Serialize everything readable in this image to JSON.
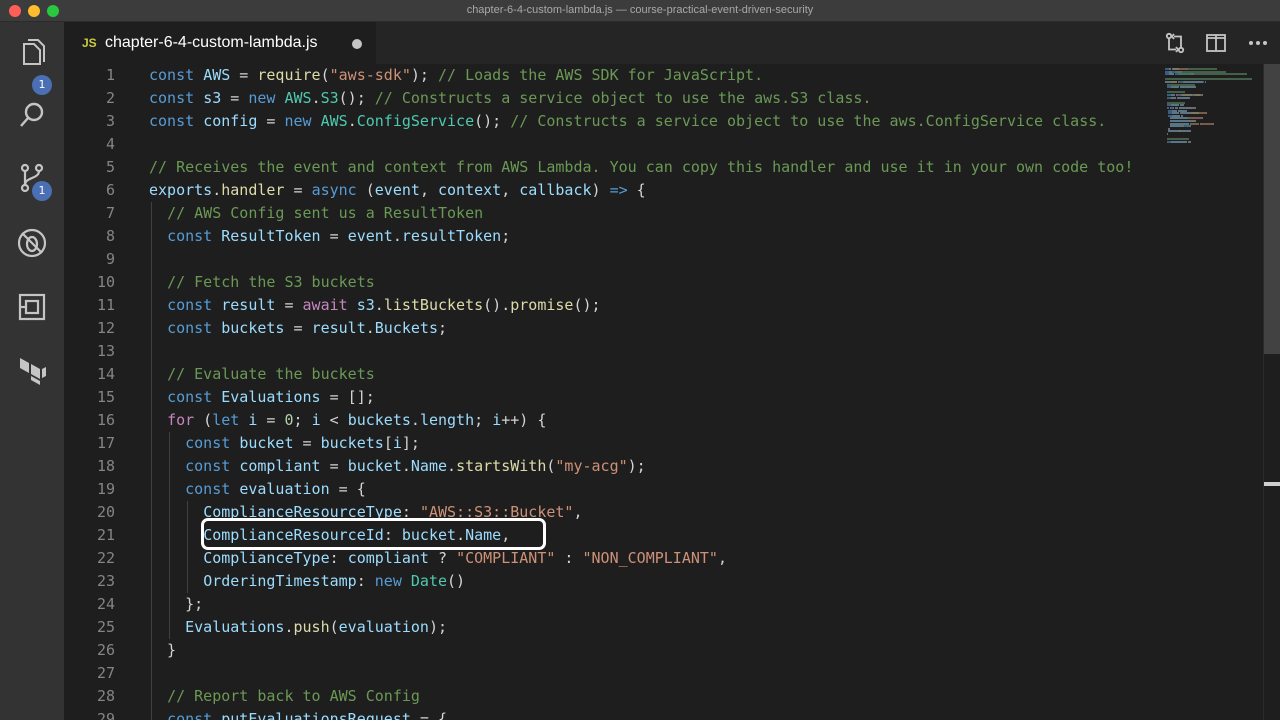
{
  "window": {
    "title": "chapter-6-4-custom-lambda.js — course-practical-event-driven-security"
  },
  "activity_bar": {
    "explorer_badge": "1",
    "source_control_badge": "1"
  },
  "tab": {
    "icon_text": "JS",
    "label": "chapter-6-4-custom-lambda.js"
  },
  "editor": {
    "lines": [
      {
        "n": "1",
        "tokens": [
          [
            "kw",
            "const "
          ],
          [
            "var",
            "AWS"
          ],
          [
            "pl",
            " = "
          ],
          [
            "fn",
            "require"
          ],
          [
            "pl",
            "("
          ],
          [
            "str",
            "\"aws-sdk\""
          ],
          [
            "pl",
            "); "
          ],
          [
            "cm",
            "// Loads the AWS SDK for JavaScript."
          ]
        ]
      },
      {
        "n": "2",
        "tokens": [
          [
            "kw",
            "const "
          ],
          [
            "var",
            "s3"
          ],
          [
            "pl",
            " = "
          ],
          [
            "kw",
            "new "
          ],
          [
            "cls",
            "AWS"
          ],
          [
            "pl",
            "."
          ],
          [
            "cls",
            "S3"
          ],
          [
            "pl",
            "(); "
          ],
          [
            "cm",
            "// Constructs a service object to use the aws.S3 class."
          ]
        ]
      },
      {
        "n": "3",
        "tokens": [
          [
            "kw",
            "const "
          ],
          [
            "var",
            "config"
          ],
          [
            "pl",
            " = "
          ],
          [
            "kw",
            "new "
          ],
          [
            "cls",
            "AWS"
          ],
          [
            "pl",
            "."
          ],
          [
            "cls",
            "ConfigService"
          ],
          [
            "pl",
            "(); "
          ],
          [
            "cm",
            "// Constructs a service object to use the aws.ConfigService class."
          ]
        ]
      },
      {
        "n": "4",
        "tokens": []
      },
      {
        "n": "5",
        "tokens": [
          [
            "cm",
            "// Receives the event and context from AWS Lambda. You can copy this handler and use it in your own code too!"
          ]
        ]
      },
      {
        "n": "6",
        "tokens": [
          [
            "var",
            "exports"
          ],
          [
            "pl",
            "."
          ],
          [
            "fn",
            "handler"
          ],
          [
            "pl",
            " = "
          ],
          [
            "kw",
            "async"
          ],
          [
            "pl",
            " ("
          ],
          [
            "var",
            "event"
          ],
          [
            "pl",
            ", "
          ],
          [
            "var",
            "context"
          ],
          [
            "pl",
            ", "
          ],
          [
            "var",
            "callback"
          ],
          [
            "pl",
            ") "
          ],
          [
            "kw",
            "=>"
          ],
          [
            "pl",
            " {"
          ]
        ]
      },
      {
        "n": "7",
        "tokens": [
          [
            "pl",
            "  "
          ],
          [
            "cm",
            "// AWS Config sent us a ResultToken"
          ]
        ]
      },
      {
        "n": "8",
        "tokens": [
          [
            "pl",
            "  "
          ],
          [
            "kw",
            "const "
          ],
          [
            "var",
            "ResultToken"
          ],
          [
            "pl",
            " = "
          ],
          [
            "var",
            "event"
          ],
          [
            "pl",
            "."
          ],
          [
            "var",
            "resultToken"
          ],
          [
            "pl",
            ";"
          ]
        ]
      },
      {
        "n": "9",
        "tokens": []
      },
      {
        "n": "10",
        "tokens": [
          [
            "pl",
            "  "
          ],
          [
            "cm",
            "// Fetch the S3 buckets"
          ]
        ]
      },
      {
        "n": "11",
        "tokens": [
          [
            "pl",
            "  "
          ],
          [
            "kw",
            "const "
          ],
          [
            "var",
            "result"
          ],
          [
            "pl",
            " = "
          ],
          [
            "ctl",
            "await "
          ],
          [
            "var",
            "s3"
          ],
          [
            "pl",
            "."
          ],
          [
            "fn",
            "listBuckets"
          ],
          [
            "pl",
            "()."
          ],
          [
            "fn",
            "promise"
          ],
          [
            "pl",
            "();"
          ]
        ]
      },
      {
        "n": "12",
        "tokens": [
          [
            "pl",
            "  "
          ],
          [
            "kw",
            "const "
          ],
          [
            "var",
            "buckets"
          ],
          [
            "pl",
            " = "
          ],
          [
            "var",
            "result"
          ],
          [
            "pl",
            "."
          ],
          [
            "var",
            "Buckets"
          ],
          [
            "pl",
            ";"
          ]
        ]
      },
      {
        "n": "13",
        "tokens": []
      },
      {
        "n": "14",
        "tokens": [
          [
            "pl",
            "  "
          ],
          [
            "cm",
            "// Evaluate the buckets"
          ]
        ]
      },
      {
        "n": "15",
        "tokens": [
          [
            "pl",
            "  "
          ],
          [
            "kw",
            "const "
          ],
          [
            "var",
            "Evaluations"
          ],
          [
            "pl",
            " = [];"
          ]
        ]
      },
      {
        "n": "16",
        "tokens": [
          [
            "pl",
            "  "
          ],
          [
            "ctl",
            "for"
          ],
          [
            "pl",
            " ("
          ],
          [
            "kw",
            "let "
          ],
          [
            "var",
            "i"
          ],
          [
            "pl",
            " = "
          ],
          [
            "num",
            "0"
          ],
          [
            "pl",
            "; "
          ],
          [
            "var",
            "i"
          ],
          [
            "pl",
            " < "
          ],
          [
            "var",
            "buckets"
          ],
          [
            "pl",
            "."
          ],
          [
            "var",
            "length"
          ],
          [
            "pl",
            "; "
          ],
          [
            "var",
            "i"
          ],
          [
            "pl",
            "++) {"
          ]
        ]
      },
      {
        "n": "17",
        "tokens": [
          [
            "pl",
            "    "
          ],
          [
            "kw",
            "const "
          ],
          [
            "var",
            "bucket"
          ],
          [
            "pl",
            " = "
          ],
          [
            "var",
            "buckets"
          ],
          [
            "pl",
            "["
          ],
          [
            "var",
            "i"
          ],
          [
            "pl",
            "];"
          ]
        ]
      },
      {
        "n": "18",
        "tokens": [
          [
            "pl",
            "    "
          ],
          [
            "kw",
            "const "
          ],
          [
            "var",
            "compliant"
          ],
          [
            "pl",
            " = "
          ],
          [
            "var",
            "bucket"
          ],
          [
            "pl",
            "."
          ],
          [
            "var",
            "Name"
          ],
          [
            "pl",
            "."
          ],
          [
            "fn",
            "startsWith"
          ],
          [
            "pl",
            "("
          ],
          [
            "str",
            "\"my-acg\""
          ],
          [
            "pl",
            ");"
          ]
        ]
      },
      {
        "n": "19",
        "tokens": [
          [
            "pl",
            "    "
          ],
          [
            "kw",
            "const "
          ],
          [
            "var",
            "evaluation"
          ],
          [
            "pl",
            " = {"
          ]
        ]
      },
      {
        "n": "20",
        "tokens": [
          [
            "pl",
            "      "
          ],
          [
            "var",
            "ComplianceResourceType"
          ],
          [
            "pl",
            ": "
          ],
          [
            "str",
            "\"AWS::S3::Bucket\""
          ],
          [
            "pl",
            ","
          ]
        ]
      },
      {
        "n": "21",
        "tokens": [
          [
            "pl",
            "      "
          ],
          [
            "var",
            "ComplianceResourceId"
          ],
          [
            "pl",
            ": "
          ],
          [
            "var",
            "bucket"
          ],
          [
            "pl",
            "."
          ],
          [
            "var",
            "Name"
          ],
          [
            "pl",
            ","
          ]
        ]
      },
      {
        "n": "22",
        "tokens": [
          [
            "pl",
            "      "
          ],
          [
            "var",
            "ComplianceType"
          ],
          [
            "pl",
            ": "
          ],
          [
            "var",
            "compliant"
          ],
          [
            "pl",
            " ? "
          ],
          [
            "str",
            "\"COMPLIANT\""
          ],
          [
            "pl",
            " : "
          ],
          [
            "str",
            "\"NON_COMPLIANT\""
          ],
          [
            "pl",
            ","
          ]
        ]
      },
      {
        "n": "23",
        "tokens": [
          [
            "pl",
            "      "
          ],
          [
            "var",
            "OrderingTimestamp"
          ],
          [
            "pl",
            ": "
          ],
          [
            "kw",
            "new "
          ],
          [
            "cls",
            "Date"
          ],
          [
            "pl",
            "()"
          ]
        ]
      },
      {
        "n": "24",
        "tokens": [
          [
            "pl",
            "    };"
          ]
        ]
      },
      {
        "n": "25",
        "tokens": [
          [
            "pl",
            "    "
          ],
          [
            "var",
            "Evaluations"
          ],
          [
            "pl",
            "."
          ],
          [
            "fn",
            "push"
          ],
          [
            "pl",
            "("
          ],
          [
            "var",
            "evaluation"
          ],
          [
            "pl",
            ");"
          ]
        ]
      },
      {
        "n": "26",
        "tokens": [
          [
            "pl",
            "  }"
          ]
        ]
      },
      {
        "n": "27",
        "tokens": []
      },
      {
        "n": "28",
        "tokens": [
          [
            "pl",
            "  "
          ],
          [
            "cm",
            "// Report back to AWS Config"
          ]
        ]
      },
      {
        "n": "29",
        "tokens": [
          [
            "pl",
            "  "
          ],
          [
            "kw",
            "const "
          ],
          [
            "var",
            "putEvaluationsRequest"
          ],
          [
            "pl",
            " = {"
          ]
        ]
      }
    ]
  }
}
